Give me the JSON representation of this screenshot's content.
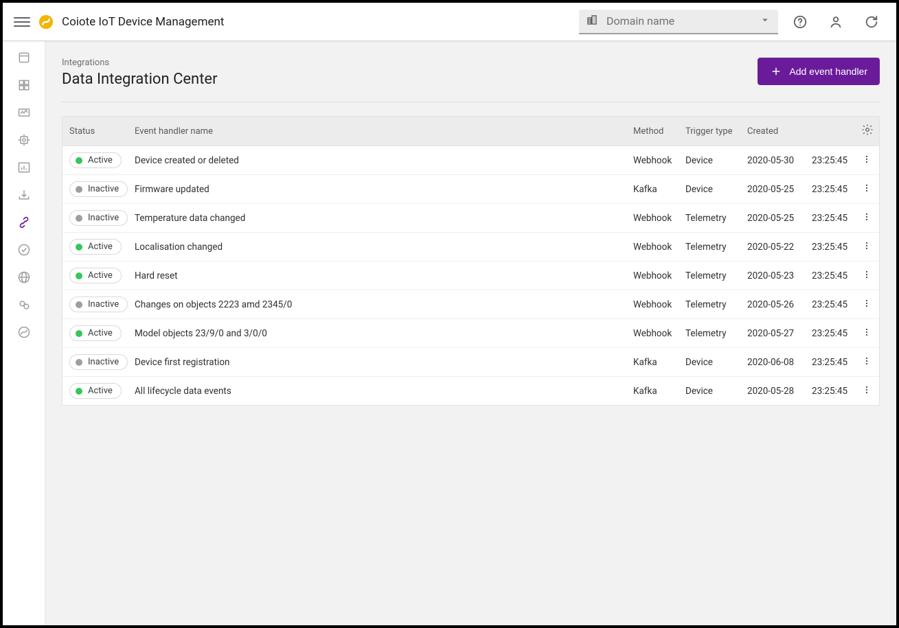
{
  "header": {
    "app_title": "Coiote IoT Device Management",
    "domain_placeholder": "Domain name"
  },
  "page": {
    "breadcrumb": "Integrations",
    "title": "Data Integration Center",
    "add_button": "Add event handler"
  },
  "table": {
    "headers": {
      "status": "Status",
      "name": "Event handler name",
      "method": "Method",
      "trigger": "Trigger type",
      "created": "Created"
    },
    "rows": [
      {
        "status": "Active",
        "name": "Device created or deleted",
        "method": "Webhook",
        "trigger": "Device",
        "date": "2020-05-30",
        "time": "23:25:45"
      },
      {
        "status": "Inactive",
        "name": "Firmware updated",
        "method": "Kafka",
        "trigger": "Device",
        "date": "2020-05-25",
        "time": "23:25:45"
      },
      {
        "status": "Inactive",
        "name": "Temperature data changed",
        "method": "Webhook",
        "trigger": "Telemetry",
        "date": "2020-05-25",
        "time": "23:25:45"
      },
      {
        "status": "Active",
        "name": "Localisation changed",
        "method": "Webhook",
        "trigger": "Telemetry",
        "date": "2020-05-22",
        "time": "23:25:45"
      },
      {
        "status": "Active",
        "name": "Hard reset",
        "method": "Webhook",
        "trigger": "Telemetry",
        "date": "2020-05-23",
        "time": "23:25:45"
      },
      {
        "status": "Inactive",
        "name": "Changes on objects 2223 amd 2345/0",
        "method": "Webhook",
        "trigger": "Telemetry",
        "date": "2020-05-26",
        "time": "23:25:45"
      },
      {
        "status": "Active",
        "name": "Model objects 23/9/0 and 3/0/0",
        "method": "Webhook",
        "trigger": "Telemetry",
        "date": "2020-05-27",
        "time": "23:25:45"
      },
      {
        "status": "Inactive",
        "name": "Device first registration",
        "method": "Kafka",
        "trigger": "Device",
        "date": "2020-06-08",
        "time": "23:25:45"
      },
      {
        "status": "Active",
        "name": "All lifecycle data events",
        "method": "Kafka",
        "trigger": "Device",
        "date": "2020-05-28",
        "time": "23:25:45"
      }
    ]
  }
}
